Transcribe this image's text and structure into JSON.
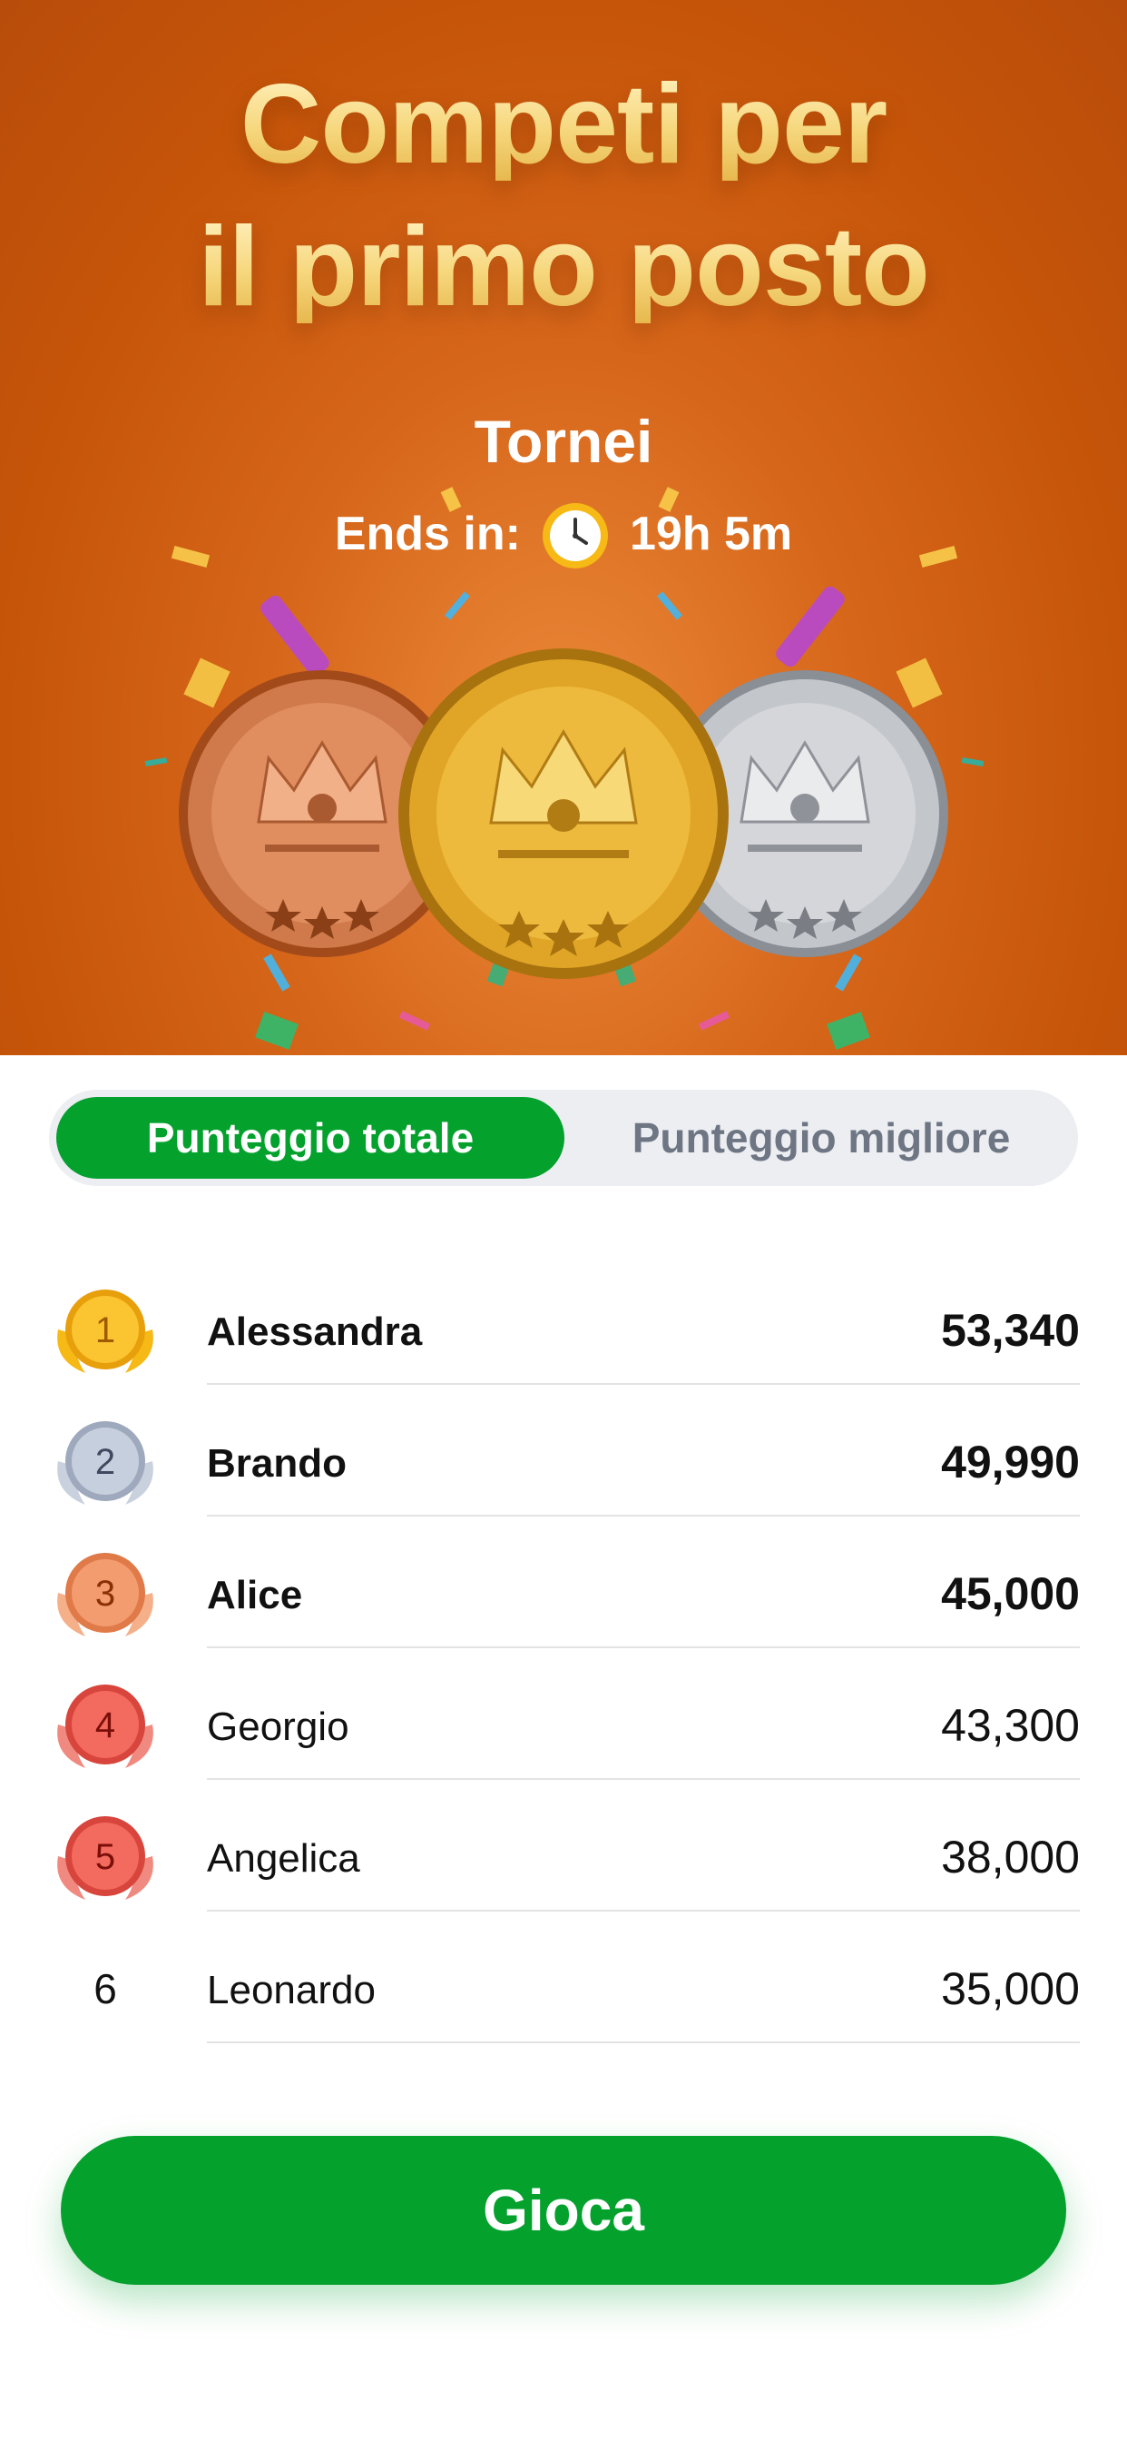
{
  "hero": {
    "headline_line1": "Competi per",
    "headline_line2": "il primo posto",
    "subtitle": "Tornei",
    "ends_label": "Ends in:",
    "ends_time": "19h 5m",
    "clock_icon": "alarm-clock-icon",
    "medals": [
      "bronze-crown-medal-icon",
      "gold-crown-medal-icon",
      "silver-crown-medal-icon"
    ]
  },
  "tabs": {
    "active": "Punteggio totale",
    "inactive": "Punteggio migliore"
  },
  "leaderboard": [
    {
      "rank": "1",
      "name": "Alessandra",
      "score": "53,340",
      "medal": "gold"
    },
    {
      "rank": "2",
      "name": "Brando",
      "score": "49,990",
      "medal": "silver"
    },
    {
      "rank": "3",
      "name": "Alice",
      "score": "45,000",
      "medal": "bronze"
    },
    {
      "rank": "4",
      "name": "Georgio",
      "score": "43,300",
      "medal": "red"
    },
    {
      "rank": "5",
      "name": "Angelica",
      "score": "38,000",
      "medal": "red"
    },
    {
      "rank": "6",
      "name": "Leonardo",
      "score": "35,000",
      "medal": "none"
    }
  ],
  "colors": {
    "accent_green": "#04a12d",
    "hero_orange": "#d6661a",
    "gold": "#f6b915",
    "silver": "#b9c3d5",
    "bronze": "#f09a6e",
    "red": "#e8534a"
  },
  "play_button": "Gioca"
}
